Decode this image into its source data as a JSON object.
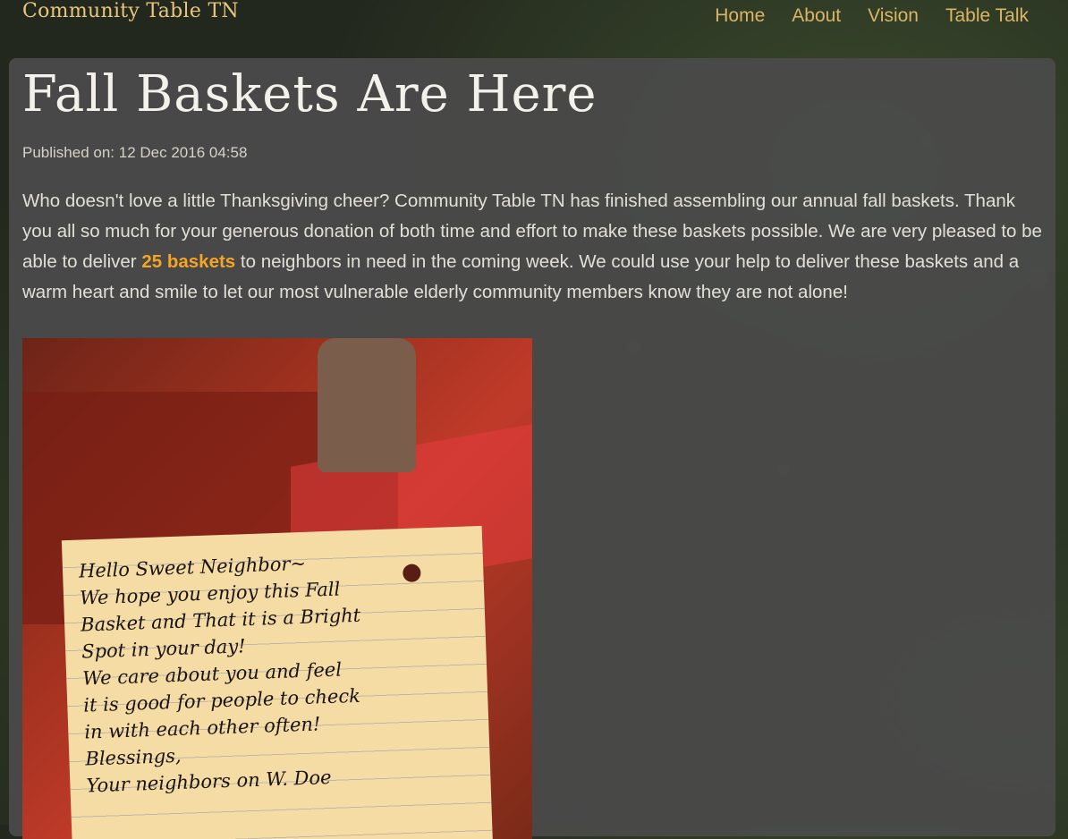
{
  "site": {
    "brand": "Community Table TN"
  },
  "nav": {
    "items": [
      "Home",
      "About",
      "Vision",
      "Table Talk"
    ]
  },
  "post": {
    "title": "Fall Baskets Are Here",
    "published": "Published on: 12 Dec 2016 04:58",
    "body_before": "Who doesn't love a little Thanksgiving cheer? Community Table TN has finished assembling our annual fall baskets. Thank you all so much for your generous donation of both time and effort to make these baskets possible. We are very pleased to be able to deliver ",
    "body_highlight": "25 baskets",
    "body_after": " to neighbors in need in the coming week. We could use your help to deliver these baskets and a warm heart and smile to let our most vulnerable elderly community members know they are not alone!"
  },
  "photo": {
    "card_text": "Hello Sweet Neighbor~\nWe hope you enjoy this Fall\nBasket and That it is a Bright\nSpot in your day!\nWe care about you and feel\nit is good for people to check\nin with each other often!\nBlessings,\nYour neighbors on W. Doe"
  },
  "colors": {
    "brand": "#e9c77a",
    "nav": "#d9b565",
    "highlight": "#f5a425"
  }
}
